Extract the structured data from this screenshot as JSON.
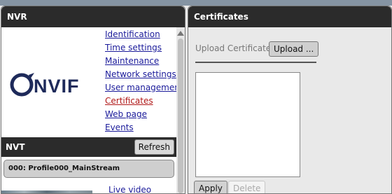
{
  "nvr_panel": {
    "title": "NVR",
    "logo_text": "ONVIF",
    "nav_items": [
      {
        "label": "Identification"
      },
      {
        "label": "Time settings"
      },
      {
        "label": "Maintenance"
      },
      {
        "label": "Network settings"
      },
      {
        "label": "User management"
      },
      {
        "label": "Certificates",
        "active": true
      },
      {
        "label": "Web page"
      },
      {
        "label": "Events"
      }
    ]
  },
  "nvt_panel": {
    "title": "NVT",
    "refresh_label": "Refresh",
    "profiles": [
      {
        "label": "000: Profile000_MainStream"
      }
    ],
    "live_video_label": "Live video"
  },
  "certificates_panel": {
    "title": "Certificates",
    "upload_label": "Upload Certificate",
    "upload_button_label": "Upload ...",
    "apply_label": "Apply",
    "delete_label": "Delete"
  },
  "colors": {
    "header_bg": "#2b2b2b",
    "link": "#1a1a9a",
    "active_link": "#b01818",
    "logo_dark": "#1e2a5a"
  }
}
